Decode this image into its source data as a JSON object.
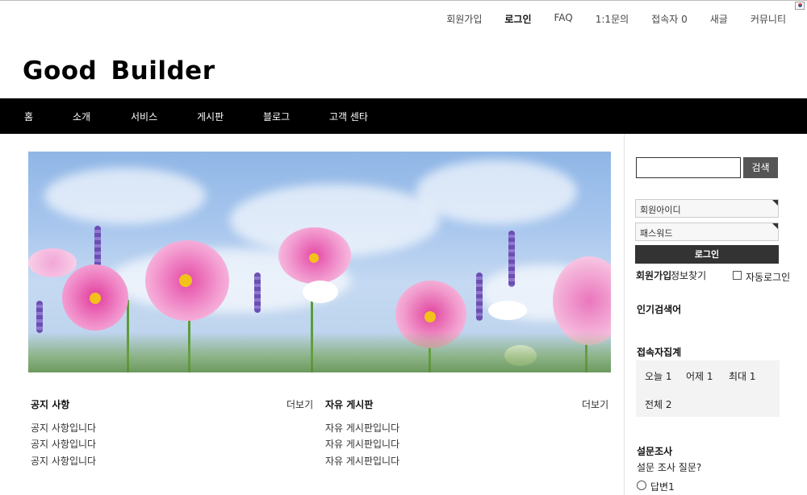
{
  "top_links": [
    "회원가입",
    "로그인",
    "FAQ",
    "1:1문의",
    "접속자 0",
    "새글",
    "커뮤니티"
  ],
  "logo": "Good  Builder",
  "nav": [
    "홈",
    "소개",
    "서비스",
    "게시판",
    "블로그",
    "고객 센타"
  ],
  "boards": {
    "notice": {
      "title": "공지 사항",
      "more": "더보기",
      "items": [
        "공지 사항입니다",
        "공지 사항입니다",
        "공지 사항입니다"
      ]
    },
    "free": {
      "title": "자유 게시판",
      "more": "더보기",
      "items": [
        "자유 게시판입니다",
        "자유 게시판입니다",
        "자유 게시판입니다"
      ]
    }
  },
  "sidebar": {
    "search": {
      "value": "",
      "button": "검색"
    },
    "login": {
      "id_placeholder": "회원아이디",
      "pw_placeholder": "패스워드",
      "button": "로그인",
      "join": "회원가입",
      "find": "정보찾기",
      "auto": "자동로그인"
    },
    "popular_title": "인기검색어",
    "stats": {
      "title": "접속자집계",
      "today": "오늘 1",
      "yesterday": "어제 1",
      "max": "최대 1",
      "total": "전체 2"
    },
    "poll": {
      "title": "설문조사",
      "question": "설문 조사 질문?",
      "option1": "답변1"
    }
  }
}
